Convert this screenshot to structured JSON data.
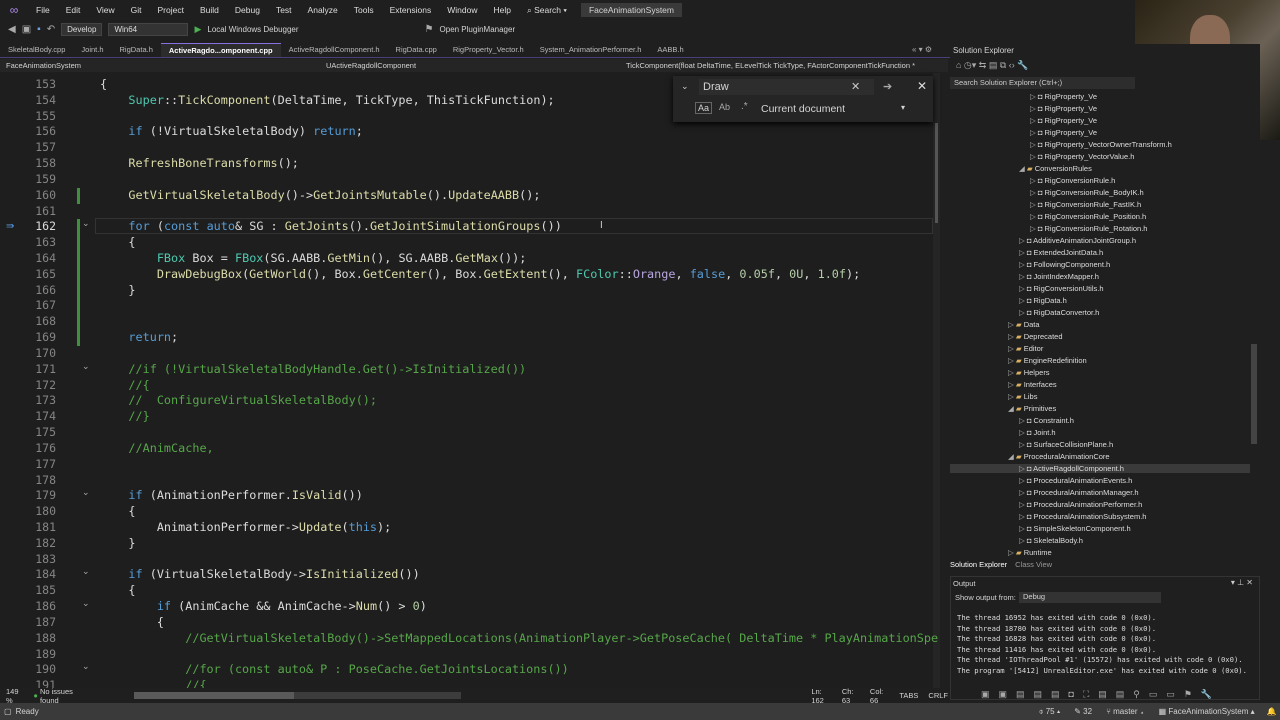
{
  "menu": {
    "items": [
      "File",
      "Edit",
      "View",
      "Git",
      "Project",
      "Build",
      "Debug",
      "Test",
      "Analyze",
      "Tools",
      "Extensions",
      "Window",
      "Help"
    ],
    "search": "Search",
    "title": "FaceAnimationSystem"
  },
  "toolbar": {
    "config": "Develop",
    "platform": "Win64",
    "debugger": "Local Windows Debugger",
    "plugin": "Open PluginManager"
  },
  "tabs": [
    "SkeletalBody.cpp",
    "Joint.h",
    "RigData.h",
    "ActiveRagdo...omponent.cpp",
    "ActiveRagdollComponent.h",
    "RigData.cpp",
    "RigProperty_Vector.h",
    "System_AnimationPerformer.h",
    "AABB.h"
  ],
  "active_tab": 3,
  "navbar": {
    "project": "FaceAnimationSystem",
    "class": "UActiveRagdollComponent",
    "member": "TickComponent(float DeltaTime, ELevelTick TickType, FActorComponentTickFunction *"
  },
  "find": {
    "query": "Draw",
    "scope": "Current document",
    "match_case": "Aa",
    "whole_word": "Ab"
  },
  "editor": {
    "current_line": 162,
    "lines": [
      {
        "n": 153,
        "t": "{"
      },
      {
        "n": 154,
        "t": "    Super::TickComponent(DeltaTime, TickType, ThisTickFunction);"
      },
      {
        "n": 155,
        "t": ""
      },
      {
        "n": 156,
        "t": "    if (!VirtualSkeletalBody) return;"
      },
      {
        "n": 157,
        "t": ""
      },
      {
        "n": 158,
        "t": "    RefreshBoneTransforms();"
      },
      {
        "n": 159,
        "t": ""
      },
      {
        "n": 160,
        "t": "    GetVirtualSkeletalBody()->GetJointsMutable().UpdateAABB();"
      },
      {
        "n": 161,
        "t": ""
      },
      {
        "n": 162,
        "t": "    for (const auto& SG : GetJoints().GetJointSimulationGroups())"
      },
      {
        "n": 163,
        "t": "    {"
      },
      {
        "n": 164,
        "t": "        FBox Box = FBox(SG.AABB.GetMin(), SG.AABB.GetMax());"
      },
      {
        "n": 165,
        "t": "        DrawDebugBox(GetWorld(), Box.GetCenter(), Box.GetExtent(), FColor::Orange, false, 0.05f, 0U, 1.0f);"
      },
      {
        "n": 166,
        "t": "    }"
      },
      {
        "n": 167,
        "t": ""
      },
      {
        "n": 168,
        "t": ""
      },
      {
        "n": 169,
        "t": "    return;"
      },
      {
        "n": 170,
        "t": ""
      },
      {
        "n": 171,
        "t": "    //if (!VirtualSkeletalBodyHandle.Get()->IsInitialized())"
      },
      {
        "n": 172,
        "t": "    //{"
      },
      {
        "n": 173,
        "t": "    //  ConfigureVirtualSkeletalBody();"
      },
      {
        "n": 174,
        "t": "    //}"
      },
      {
        "n": 175,
        "t": ""
      },
      {
        "n": 176,
        "t": "    //AnimCache,"
      },
      {
        "n": 177,
        "t": ""
      },
      {
        "n": 178,
        "t": ""
      },
      {
        "n": 179,
        "t": "    if (AnimationPerformer.IsValid())"
      },
      {
        "n": 180,
        "t": "    {"
      },
      {
        "n": 181,
        "t": "        AnimationPerformer->Update(this);"
      },
      {
        "n": 182,
        "t": "    }"
      },
      {
        "n": 183,
        "t": ""
      },
      {
        "n": 184,
        "t": "    if (VirtualSkeletalBody->IsInitialized())"
      },
      {
        "n": 185,
        "t": "    {"
      },
      {
        "n": 186,
        "t": "        if (AnimCache && AnimCache->Num() > 0)"
      },
      {
        "n": 187,
        "t": "        {"
      },
      {
        "n": 188,
        "t": "            //GetVirtualSkeletalBody()->SetMappedLocations(AnimationPlayer->GetPoseCache( DeltaTime * PlayAnimationSpe"
      },
      {
        "n": 189,
        "t": ""
      },
      {
        "n": 190,
        "t": "            //for (const auto& P : PoseCache.GetJointsLocations())"
      },
      {
        "n": 191,
        "t": "            //{"
      }
    ],
    "folds": [
      162,
      171,
      179,
      184,
      186,
      190
    ]
  },
  "editor_status": {
    "zoom": "149 %",
    "issues": "No issues found",
    "ln": "Ln: 162",
    "ch": "Ch: 63",
    "col": "Col: 66",
    "tabs": "TABS",
    "eol": "CRLF"
  },
  "solution_explorer": {
    "title": "Solution Explorer",
    "search": "Search Solution Explorer (Ctrl+;)",
    "tabs": [
      "Solution Explorer",
      "Class View"
    ],
    "items": [
      {
        "l": "RigProperty_Ve",
        "d": 4,
        "k": "h"
      },
      {
        "l": "RigProperty_Ve",
        "d": 4,
        "k": "h"
      },
      {
        "l": "RigProperty_Ve",
        "d": 4,
        "k": "h"
      },
      {
        "l": "RigProperty_Ve",
        "d": 4,
        "k": "h"
      },
      {
        "l": "RigProperty_VectorOwnerTransform.h",
        "d": 4,
        "k": "h"
      },
      {
        "l": "RigProperty_VectorValue.h",
        "d": 4,
        "k": "h"
      },
      {
        "l": "ConversionRules",
        "d": 3,
        "k": "f"
      },
      {
        "l": "RigConversionRule.h",
        "d": 4,
        "k": "h"
      },
      {
        "l": "RigConversionRule_BodyIK.h",
        "d": 4,
        "k": "h"
      },
      {
        "l": "RigConversionRule_FastIK.h",
        "d": 4,
        "k": "h"
      },
      {
        "l": "RigConversionRule_Position.h",
        "d": 4,
        "k": "h"
      },
      {
        "l": "RigConversionRule_Rotation.h",
        "d": 4,
        "k": "h"
      },
      {
        "l": "AdditiveAnimationJointGroup.h",
        "d": 3,
        "k": "h"
      },
      {
        "l": "ExtendedJointData.h",
        "d": 3,
        "k": "h"
      },
      {
        "l": "FollowingComponent.h",
        "d": 3,
        "k": "h"
      },
      {
        "l": "JointIndexMapper.h",
        "d": 3,
        "k": "h"
      },
      {
        "l": "RigConversionUtils.h",
        "d": 3,
        "k": "h"
      },
      {
        "l": "RigData.h",
        "d": 3,
        "k": "h"
      },
      {
        "l": "RigDataConvertor.h",
        "d": 3,
        "k": "h"
      },
      {
        "l": "Data",
        "d": 2,
        "k": "f"
      },
      {
        "l": "Deprecated",
        "d": 2,
        "k": "f"
      },
      {
        "l": "Editor",
        "d": 2,
        "k": "f"
      },
      {
        "l": "EngineRedefinition",
        "d": 2,
        "k": "f"
      },
      {
        "l": "Helpers",
        "d": 2,
        "k": "f"
      },
      {
        "l": "Interfaces",
        "d": 2,
        "k": "f"
      },
      {
        "l": "Libs",
        "d": 2,
        "k": "f"
      },
      {
        "l": "Primitives",
        "d": 2,
        "k": "f"
      },
      {
        "l": "Constraint.h",
        "d": 3,
        "k": "h"
      },
      {
        "l": "Joint.h",
        "d": 3,
        "k": "h"
      },
      {
        "l": "SurfaceCollisionPlane.h",
        "d": 3,
        "k": "h"
      },
      {
        "l": "ProceduralAnimationCore",
        "d": 2,
        "k": "f"
      },
      {
        "l": "ActiveRagdollComponent.h",
        "d": 3,
        "k": "h",
        "sel": true
      },
      {
        "l": "ProceduralAnimationEvents.h",
        "d": 3,
        "k": "h"
      },
      {
        "l": "ProceduralAnimationManager.h",
        "d": 3,
        "k": "h"
      },
      {
        "l": "ProceduralAnimationPerformer.h",
        "d": 3,
        "k": "h"
      },
      {
        "l": "ProceduralAnimationSubsystem.h",
        "d": 3,
        "k": "h"
      },
      {
        "l": "SimpleSkeletonComponent.h",
        "d": 3,
        "k": "h"
      },
      {
        "l": "SkeletalBody.h",
        "d": 3,
        "k": "h"
      },
      {
        "l": "Runtime",
        "d": 2,
        "k": "f"
      }
    ]
  },
  "output": {
    "title": "Output",
    "show_from_label": "Show output from:",
    "source": "Debug",
    "lines": [
      "The thread 16952 has exited with code 0 (0x0).",
      "The thread 18780 has exited with code 0 (0x0).",
      "The thread 16828 has exited with code 0 (0x0).",
      "The thread 11416 has exited with code 0 (0x0).",
      "The thread 'IOThreadPool #1' (15572) has exited with code 0 (0x0).",
      "The program '[5412] UnrealEditor.exe' has exited with code 0 (0x0)."
    ]
  },
  "status": {
    "ready": "Ready",
    "up": "75",
    "edits": "32",
    "branch": "master",
    "repo": "FaceAnimationSystem"
  }
}
